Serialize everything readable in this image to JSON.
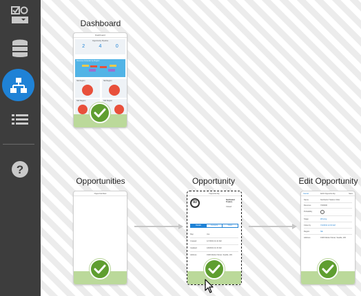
{
  "sidebar": {
    "items": [
      {
        "name": "checklist-icon"
      },
      {
        "name": "database-icon"
      },
      {
        "name": "sitemap-icon",
        "active": true
      },
      {
        "name": "list-icon"
      },
      {
        "name": "help-icon"
      }
    ]
  },
  "screens": {
    "dashboard": {
      "title": "Dashboard",
      "mini_title": "Dashboard",
      "pipeline_title": "Opportunity Pipeline",
      "pipeline_values": [
        "2",
        "4",
        "0"
      ],
      "chart_title": "Revenue Forecast by Region",
      "regions": [
        "NE Region",
        "SE Region",
        "NW Region",
        "SW Region"
      ],
      "complete": true
    },
    "opportunities": {
      "title": "Opportunities",
      "mini_title": "Opportunities",
      "complete": true
    },
    "opportunity": {
      "title": "Opportunity",
      "mini_title": "Opportunity",
      "score": "83",
      "company": "Northwind Traders",
      "status": "Closed",
      "tabs": [
        "Details",
        "Contacts",
        "Notes"
      ],
      "fields": [
        {
          "label": "Rep",
          "value": "Joe"
        },
        {
          "label": "Created",
          "value": "1/7/2019 11:10 AM"
        },
        {
          "label": "Updated",
          "value": "1/8/2019 11:15 AM"
        },
        {
          "label": "Address",
          "value": "1900 Market Street, Seattle, WA"
        }
      ],
      "complete": true,
      "selected": true
    },
    "edit_opportunity": {
      "title": "Edit Opportunity",
      "mini_title": "Edit Opportunity",
      "cancel": "Cancel",
      "save": "Save",
      "fields": [
        {
          "label": "Name",
          "value": "Northwind Traders Order"
        },
        {
          "label": "Revenue",
          "value": "7000000"
        },
        {
          "label": "Probability",
          "value": "83"
        },
        {
          "label": "Stage",
          "value": "Winning"
        },
        {
          "label": "Close by",
          "value": "7/3/2019 12:00 AM"
        },
        {
          "label": "Region",
          "value": "NE"
        },
        {
          "label": "Address",
          "value": "1900 Market Street, Seattle, WA"
        }
      ],
      "complete": true
    }
  },
  "colors": {
    "sidebar_bg": "#3d3d3d",
    "active_nav": "#1f82d6",
    "check_green": "#5f9e30",
    "footer_green": "#bbd99a",
    "mini_blue": "#1f82d6",
    "mini_red": "#e8503b"
  }
}
